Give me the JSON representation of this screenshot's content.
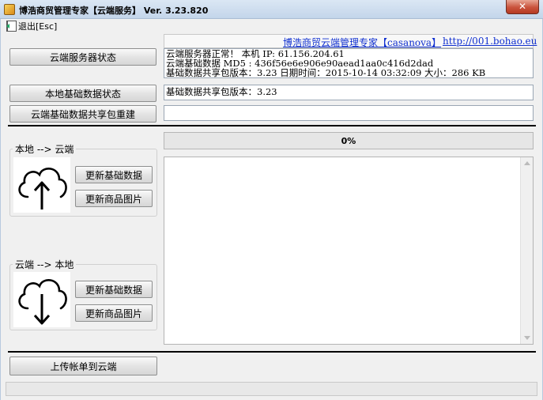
{
  "window": {
    "title": "博浩商贸管理专家【云端服务】 Ver. 3.23.820",
    "close": "✕"
  },
  "menu": {
    "exit_label": "退出[Esc]"
  },
  "header_link": {
    "text": "博浩商贸云端管理专家【casanova】",
    "url": "http://001.bohao.eu"
  },
  "buttons": {
    "cloud_server_status": "云端服务器状态",
    "local_base_data_status": "本地基础数据状态",
    "rebuild_cloud_package": "云端基础数据共享包重建",
    "update_base_data": "更新基础数据",
    "update_product_images": "更新商品图片",
    "upload_bills": "上传帐单到云端"
  },
  "server_status": {
    "line1": "云端服务器正常！   本机 IP: 61.156.204.61",
    "line2": "云端基础数据  MD5 : 436f56e6e906e90aead1aa0c416d2dad",
    "line3": "基础数据共享包版本：3.23  日期时间：2015-10-14 03:32:09  大小：286 KB"
  },
  "local_status": {
    "text": "基础数据共享包版本：3.23"
  },
  "rebuild_status": {
    "text": ""
  },
  "groups": {
    "local_to_cloud": "本地 --> 云端",
    "cloud_to_local": "云端 --> 本地"
  },
  "progress": {
    "percent": 0,
    "label": "0%"
  },
  "log": {
    "text": ""
  }
}
